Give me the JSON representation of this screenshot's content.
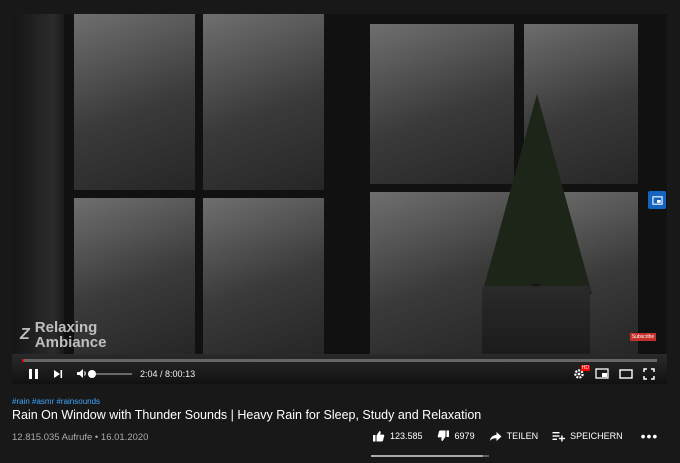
{
  "player": {
    "watermark_logo": "Z",
    "watermark_line1": "Relaxing",
    "watermark_line2": "Ambiance",
    "subscribe_tag": "Subscribe",
    "current_time": "2:04",
    "duration": "8:00:13",
    "time_separator": " / ",
    "progress_fraction": 0.0026,
    "volume_fraction": 0.0,
    "hd_badge": "HD"
  },
  "video": {
    "hashtags": "#rain #asmr #rainsounds",
    "title": "Rain On Window with Thunder Sounds | Heavy Rain for Sleep, Study and Relaxation",
    "views": "12.815.035 Aufrufe",
    "separator": " • ",
    "date": "16.01.2020"
  },
  "actions": {
    "likes": "123.585",
    "dislikes": "6979",
    "share_label": "TEILEN",
    "save_label": "SPEICHERN",
    "more_label": "•••",
    "like_ratio": 0.947
  },
  "colors": {
    "accent_red": "#ff0000",
    "link_blue": "#3ea6ff",
    "background": "#181818"
  }
}
